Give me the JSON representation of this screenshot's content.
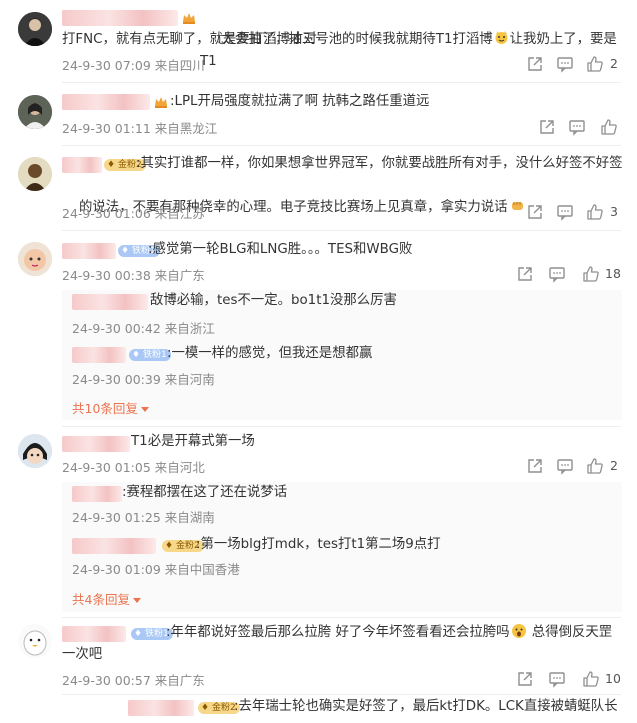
{
  "comments": [
    {
      "text": ":太会抽了，抽三号池的时候我就期待T1打滔博",
      "text_b": "让我奶上了，要是T1",
      "text2": "打FNC，就有点无聊了，就是要打滔博才对",
      "time": "24-9-30 07:09 来自四川",
      "likes": "2"
    },
    {
      "text": ":LPL开局强度就拉满了啊 抗韩之路任重道远",
      "time": "24-9-30 01:11 来自黑龙江",
      "likes": ""
    },
    {
      "badge": "金粉2",
      "text": ":其实打谁都一样，你如果想拿世界冠军，你就要战胜所有对手，没什么好签不好签",
      "text2": "的说法，不要有那种侥幸的心理。电子竞技比赛场上见真章，拿实力说话",
      "time": "24-9-30 01:06 来自江苏",
      "likes": "3"
    },
    {
      "badge": "铁粉1",
      "text": ":感觉第一轮BLG和LNG胜。。。TES和WBG败",
      "time": "24-9-30 00:38 来自广东",
      "likes": "18",
      "replies": [
        {
          "text": "敌博必输，tes不一定。bo1t1没那么厉害",
          "time": "24-9-30 00:42 来自浙江"
        },
        {
          "badge": "铁粉1",
          "text": ":一模一样的感觉，但我还是想都赢",
          "time": "24-9-30 00:39 来自河南"
        }
      ],
      "more": "共10条回复"
    },
    {
      "text": "T1必是开幕式第一场",
      "time": "24-9-30 01:05 来自河北",
      "likes": "2",
      "replies": [
        {
          "text": ":赛程都摆在这了还在说梦话",
          "time": "24-9-30 01:25 来自湖南"
        },
        {
          "badge": "金粉2",
          "text": ":第一场blg打mdk，tes打t1第二场9点打",
          "time": "24-9-30 01:09 来自中国香港"
        }
      ],
      "more": "共4条回复"
    },
    {
      "badge": "铁粉1",
      "text": ":年年都说好签最后那么拉胯  好了今年坏签看看还会拉胯吗",
      "text_b": " 总得倒反天罡",
      "text2": "一次吧",
      "time": "24-9-30 00:57 来自广东",
      "likes": "10"
    },
    {
      "badge": "金粉2",
      "text": ":去年瑞士轮也确实是好签了，最后kt打DK。LCK直接被蜻蜓队长"
    }
  ]
}
